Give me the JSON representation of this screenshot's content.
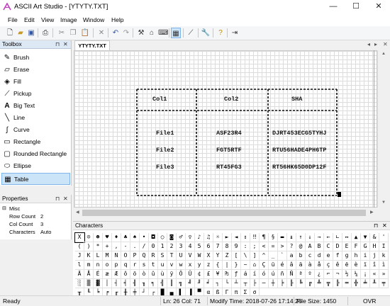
{
  "window": {
    "title": "ASCII Art Studio - [YTYTY.TXT]",
    "minimize": "—",
    "maximize": "☐",
    "close": "✕"
  },
  "menu": [
    "File",
    "Edit",
    "View",
    "Image",
    "Window",
    "Help"
  ],
  "toolbar_icons": [
    "new-file-icon",
    "open-folder-icon",
    "save-icon",
    "print-icon",
    "cut-icon",
    "copy-icon",
    "paste-icon",
    "delete-icon",
    "undo-icon",
    "redo-icon",
    "tools-icon",
    "export-icon",
    "keyboard-icon",
    "grid-icon",
    "eyedropper-icon",
    "wrench-icon",
    "help-icon",
    "exit-icon"
  ],
  "toolbox": {
    "title": "Toolbox",
    "pin": "⊓",
    "close": "✕",
    "tools": [
      {
        "label": "Brush",
        "icon": "brush-icon",
        "glyph": "✎"
      },
      {
        "label": "Erase",
        "icon": "eraser-icon",
        "glyph": "▱"
      },
      {
        "label": "Fill",
        "icon": "fill-icon",
        "glyph": "◈"
      },
      {
        "label": "Pickup",
        "icon": "eyedropper-icon",
        "glyph": "⟋"
      },
      {
        "label": "Big Text",
        "icon": "big-text-icon",
        "glyph": "A"
      },
      {
        "label": "Line",
        "icon": "line-icon",
        "glyph": "╲"
      },
      {
        "label": "Curve",
        "icon": "curve-icon",
        "glyph": "∫"
      },
      {
        "label": "Rectangle",
        "icon": "rectangle-icon",
        "glyph": "▭"
      },
      {
        "label": "Rounded Rectangle",
        "icon": "rounded-rectangle-icon",
        "glyph": "▢"
      },
      {
        "label": "Ellipse",
        "icon": "ellipse-icon",
        "glyph": "⬭"
      },
      {
        "label": "Table",
        "icon": "table-icon",
        "glyph": "▦"
      }
    ],
    "selected": "Table"
  },
  "properties": {
    "title": "Properties",
    "group": "Misc",
    "rows": [
      {
        "name": "Row Count",
        "value": "2"
      },
      {
        "name": "Col Count",
        "value": "3"
      },
      {
        "name": "Characters",
        "value": "Auto"
      }
    ]
  },
  "document": {
    "tab": "YTYTY.TXT",
    "nav_left": "◂",
    "nav_right": "▸",
    "close": "✕",
    "table": {
      "headers": [
        "Col1",
        "Col2",
        "SHA"
      ],
      "rows": [
        [
          "File1",
          "ASF23R4",
          "DJRT453ECG5TYHJ"
        ],
        [
          "File2",
          "FGT5RTF",
          "RTU56HADE4PH6TP"
        ],
        [
          "File3",
          "RT45FG3",
          "RT56HK65D0DP12F"
        ]
      ]
    }
  },
  "characters_panel": {
    "title": "Characters",
    "rows": [
      [
        "X",
        "☺",
        "☻",
        "♥",
        "♦",
        "♣",
        "♠",
        "•",
        "◘",
        "○",
        "◙",
        "♂",
        "♀",
        "♪",
        "♫",
        "☼",
        "►",
        "◄",
        "↕",
        "‼",
        "¶",
        "§",
        "▬",
        "↨",
        "↑",
        "↓",
        "→",
        "←",
        "∟",
        "↔",
        "▲",
        "▼"
      ],
      [
        "&",
        "'",
        "(",
        ")",
        "*",
        "+",
        ",",
        "-",
        ".",
        "/",
        "0",
        "1",
        "2",
        "3",
        "4",
        "5",
        "6",
        "7",
        "8",
        "9",
        ":",
        ";",
        "<",
        "=",
        ">",
        "?",
        "@",
        "A",
        "B",
        "C",
        "D",
        "E"
      ],
      [
        "F",
        "G",
        "H",
        "I",
        "J",
        "K",
        "L",
        "M",
        "N",
        "O",
        "P",
        "Q",
        "R",
        "S",
        "T",
        "U",
        "V",
        "W",
        "X",
        "Y",
        "Z",
        "[",
        "\\",
        "]",
        "^",
        "_",
        "`",
        "a",
        "b",
        "c",
        "d",
        "e"
      ],
      [
        "f",
        "g",
        "h",
        "i",
        "j",
        "k",
        "l",
        "m",
        "n",
        "o",
        "p",
        "q",
        "r",
        "s",
        "t",
        "u",
        "v",
        "w",
        "x",
        "y",
        "z",
        "{",
        "|",
        "}",
        "~",
        "⌂",
        "Ç",
        "ü",
        "é",
        "â",
        "ä",
        "à"
      ],
      [
        "å",
        "ç",
        "ê",
        "ë",
        "è",
        "ï",
        "î",
        "ì",
        "Ä",
        "Å",
        "É",
        "æ",
        "Æ",
        "ô",
        "ö",
        "ò",
        "û",
        "ù",
        "ÿ",
        "Ö",
        "Ü",
        "¢",
        "£",
        "¥",
        "₧",
        "ƒ",
        "á",
        "í",
        "ó",
        "ú",
        "ñ",
        "Ñ"
      ],
      [
        "ª",
        "º",
        "¿",
        "⌐",
        "¬",
        "½",
        "¼",
        "¡",
        "«",
        "»",
        "░",
        "▒",
        "▓",
        "│",
        "┤",
        "╡",
        "╢",
        "╖",
        "╕",
        "╣",
        "║",
        "╗",
        "╝",
        "╜",
        "╛",
        "┐",
        "└",
        "┴",
        "┬",
        "├",
        "─",
        "┼"
      ],
      [
        "╞",
        "╟",
        "╚",
        "╔",
        "╩",
        "╦",
        "╠",
        "═",
        "╬",
        "╧",
        "╨",
        "╤",
        "╥",
        "╙",
        "╘",
        "╒",
        "╓",
        "╫",
        "╪",
        "┘",
        "┌",
        "█",
        "▄",
        "▌",
        "▐",
        "▀",
        "α",
        "ß",
        "Γ",
        "π",
        "Σ",
        "σ"
      ]
    ]
  },
  "status": {
    "ready": "Ready",
    "position": "Ln: 26  Col: 71",
    "modify_time": "Modify Time: 2018-07-26 17:14:26",
    "file_size": "File Size: 1450",
    "mode": "OVR"
  }
}
